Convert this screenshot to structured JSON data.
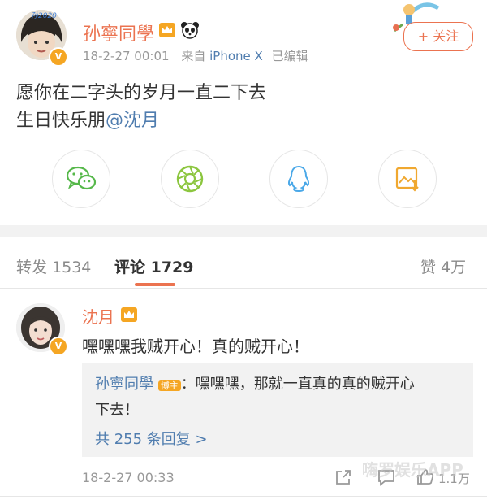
{
  "post": {
    "author": "孙寧同學",
    "timestamp": "18-2-27 00:01",
    "source_prefix": "来自",
    "source_device": "iPhone X",
    "edited": "已编辑",
    "follow_label": "+ 关注",
    "line1": "愿你在二字头的岁月一直二下去",
    "line2_prefix": "生日快乐朋",
    "mention": "@沈月",
    "avatar_text": "孙2020"
  },
  "share_icons": [
    "wechat-icon",
    "moments-icon",
    "qq-icon",
    "save-image-icon"
  ],
  "tabs": {
    "repost": "转发 1534",
    "comment": "评论 1729",
    "like": "赞 4万"
  },
  "comment": {
    "author": "沈月",
    "text": "嘿嘿嘿我贼开心！真的贼开心！",
    "reply": {
      "author": "孙寧同學",
      "badge": "博主",
      "text_line1": "：嘿嘿嘿，那就一直真的真的贼开心",
      "text_line2": "下去！",
      "more": "共 255 条回复 >"
    },
    "timestamp": "18-2-27 00:33",
    "like_count": "1.1万"
  },
  "watermark": "嗨罗娱乐APP",
  "colors": {
    "accent": "#eb7350",
    "link": "#507daf",
    "gold": "#f5a623"
  }
}
